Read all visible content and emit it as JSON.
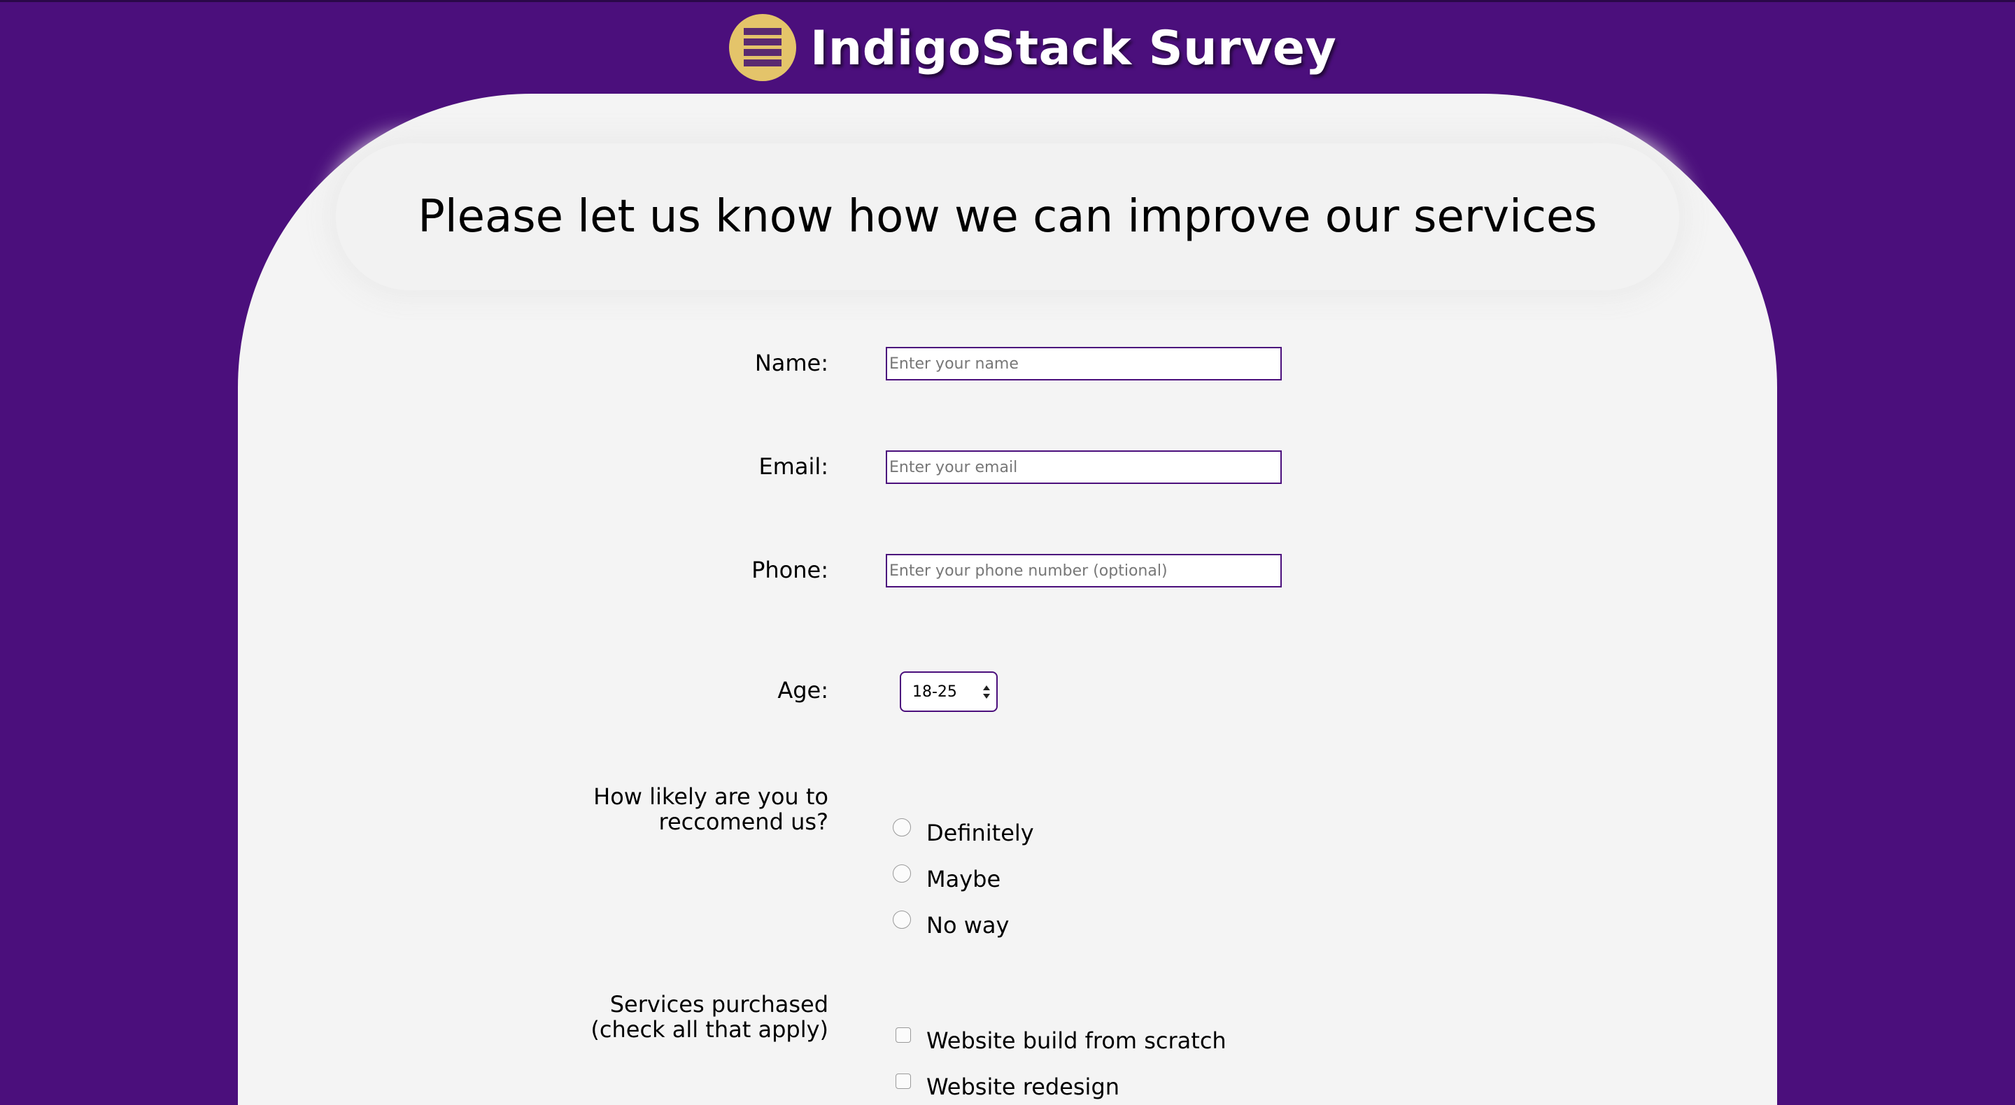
{
  "header": {
    "site_title": "IndigoStack Survey",
    "logo_icon": "stacked-bars-icon",
    "colors": {
      "background": "#4b0f7c",
      "logo_circle": "#e4c46a",
      "logo_bars": "#5a2a70"
    }
  },
  "form": {
    "heading": "Please let us know how we can improve our services",
    "name": {
      "label": "Name:",
      "placeholder": "Enter your name"
    },
    "email": {
      "label": "Email:",
      "placeholder": "Enter your email"
    },
    "phone": {
      "label": "Phone:",
      "placeholder": "Enter your phone number (optional)"
    },
    "age": {
      "label": "Age:",
      "selected": "18-25"
    },
    "recommend": {
      "label_line1": "How likely are you to",
      "label_line2": "reccomend us?",
      "options": [
        "Definitely",
        "Maybe",
        "No way"
      ]
    },
    "services": {
      "label_line1": "Services purchased",
      "label_line2": "(check all that apply)",
      "options": [
        "Website build from scratch",
        "Website redesign"
      ]
    }
  }
}
